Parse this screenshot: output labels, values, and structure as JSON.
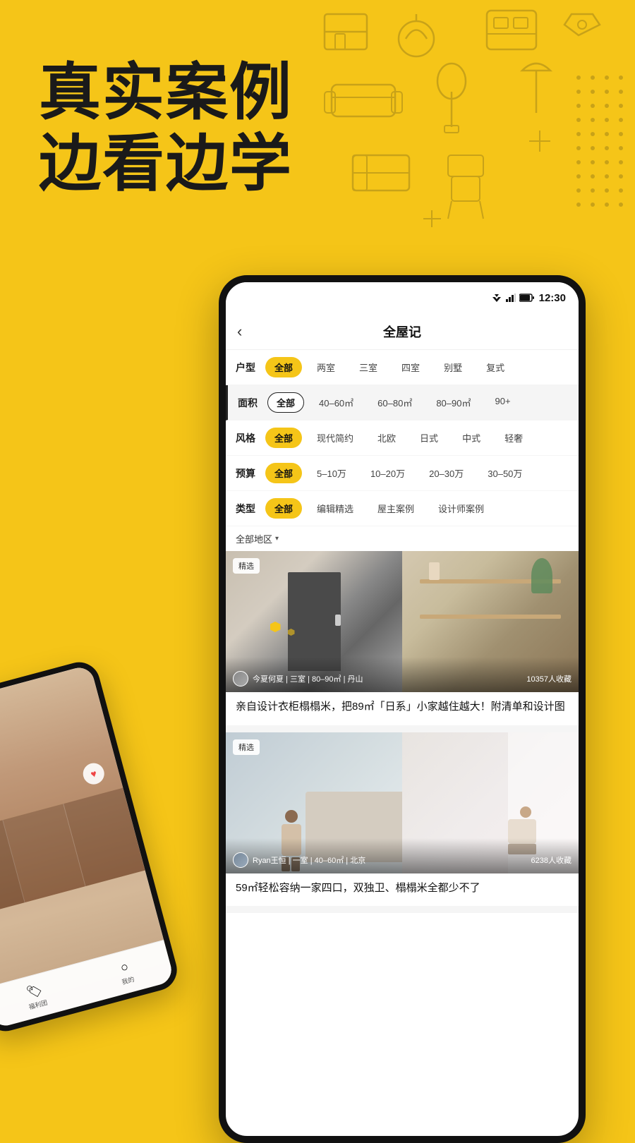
{
  "hero": {
    "line1": "真实案例",
    "line2": "边看边学"
  },
  "status_bar": {
    "time": "12:30"
  },
  "app": {
    "title": "全屋记",
    "back_label": "‹"
  },
  "filters": {
    "row1": {
      "label": "户型",
      "tags": [
        "全部",
        "两室",
        "三室",
        "四室",
        "别墅",
        "复式"
      ]
    },
    "row2": {
      "label": "面积",
      "tags": [
        "全部",
        "40–60㎡",
        "60–80㎡",
        "80–90㎡",
        "90+"
      ]
    },
    "row3": {
      "label": "风格",
      "tags": [
        "全部",
        "现代简约",
        "北欧",
        "日式",
        "中式",
        "轻奢"
      ]
    },
    "row4": {
      "label": "预算",
      "tags": [
        "全部",
        "5–10万",
        "10–20万",
        "20–30万",
        "30–50万"
      ]
    },
    "row5": {
      "label": "类型",
      "tags": [
        "全部",
        "编辑精选",
        "屋主案例",
        "设计师案例"
      ]
    },
    "location": "全部地区",
    "location_arrow": "▾"
  },
  "cards": [
    {
      "badge": "精选",
      "user_name": "今夏何夏",
      "meta": "三室 | 80–90㎡ | 丹山",
      "saves": "10357人收藏",
      "title": "亲自设计衣柜榻榻米，把89㎡「日系」小家越住越大！附清单和设计图"
    },
    {
      "badge": "精选",
      "user_name": "Ryan王恒",
      "meta": "一室 | 40–60㎡ | 北京",
      "saves": "6238人收藏",
      "title": "59㎡轻松容纳一家四口，双独卫、榻榻米全都少不了"
    }
  ],
  "small_phone": {
    "nav_items": [
      {
        "icon": "🏠",
        "label": "福利团"
      },
      {
        "icon": "○",
        "label": "我的"
      }
    ]
  }
}
